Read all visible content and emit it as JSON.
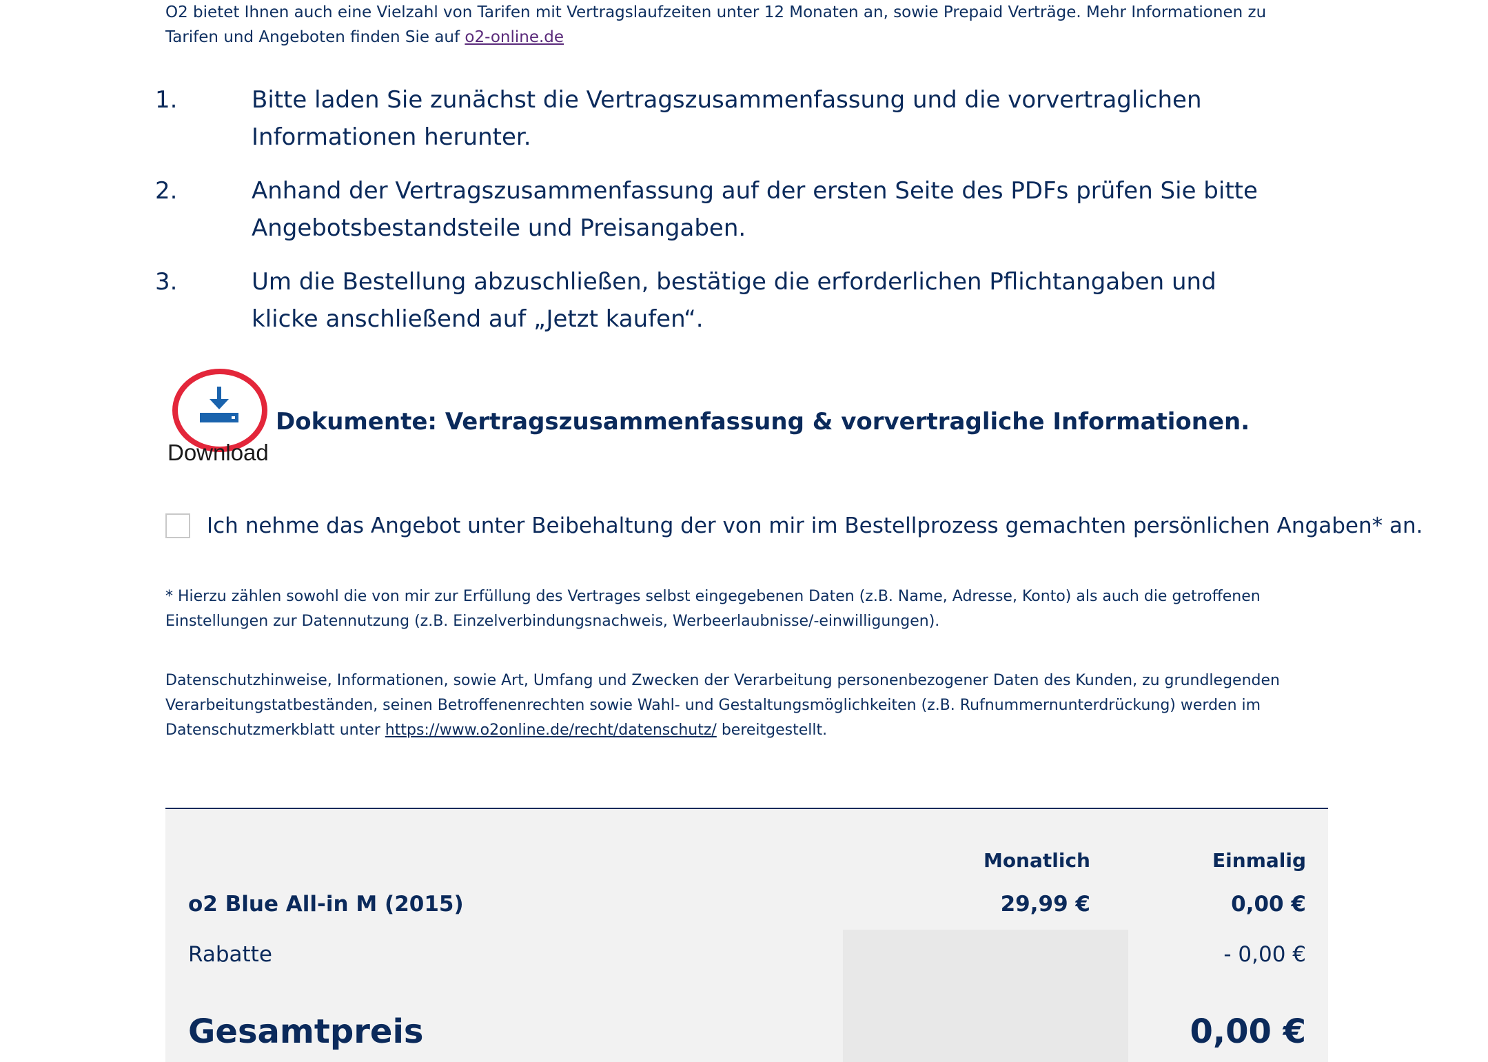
{
  "intro": {
    "text": "O2 bietet Ihnen auch eine Vielzahl von Tarifen mit Vertragslaufzeiten unter 12 Monaten an, sowie Prepaid Verträge. Mehr Informationen zu Tarifen und Angeboten finden Sie auf ",
    "link": "o2-online.de"
  },
  "steps": [
    {
      "num": "1.",
      "text": "Bitte laden Sie zunächst die Vertragszusammenfassung und die vorvertraglichen Informationen herunter."
    },
    {
      "num": "2.",
      "text": "Anhand der Vertragszusammenfassung auf der ersten Seite des PDFs prüfen Sie bitte Angebotsbestandsteile und Preisangaben."
    },
    {
      "num": "3.",
      "text": "Um die Bestellung abzuschließen, bestätige die erforderlichen Pflichtangaben und klicke anschließend auf „Jetzt kaufen“."
    }
  ],
  "download": {
    "label": "Download",
    "icon": "download-icon",
    "title": "Dokumente: Vertragszusammenfassung & vorvertragliche Informationen.",
    "highlight_color": "#e3263a",
    "icon_color": "#1a63ad"
  },
  "consent": {
    "label": "Ich nehme das Angebot unter Beibehaltung der von mir im Bestellprozess gemachten persönlichen Angaben* an.",
    "checked": false
  },
  "footnote": "* Hierzu zählen sowohl die von mir zur Erfüllung des Vertrages selbst eingegebenen Daten (z.B. Name, Adresse, Konto) als auch die getroffenen Einstellungen zur Datennutzung (z.B. Einzelverbindungsnachweis, Werbeerlaubnisse/-einwilligungen).",
  "privacy": {
    "text_before": "Datenschutzhinweise, Informationen, sowie Art, Umfang und Zwecken der Verarbeitung personenbezogener Daten des Kunden, zu grundlegenden Verarbeitungstatbeständen, seinen Betroffenenrechten sowie Wahl- und Gestaltungsmöglichkeiten (z.B. Rufnummernunterdrückung) werden im Datenschutzmerkblatt unter ",
    "link": "https://www.o2online.de/recht/datenschutz/",
    "text_after": " bereitgestellt."
  },
  "prices": {
    "header_monthly": "Monatlich",
    "header_once": "Einmalig",
    "tariff": {
      "name": "o2 Blue All-in M (2015)",
      "monthly": "29,99 €",
      "once": "0,00 €"
    },
    "discount": {
      "name": "Rabatte",
      "monthly": "",
      "once": "- 0,00 €"
    },
    "total": {
      "name": "Gesamtpreis",
      "monthly": "",
      "once": "0,00 €"
    }
  },
  "colors": {
    "text": "#0b2a5b",
    "box_bg": "#f2f2f2"
  }
}
